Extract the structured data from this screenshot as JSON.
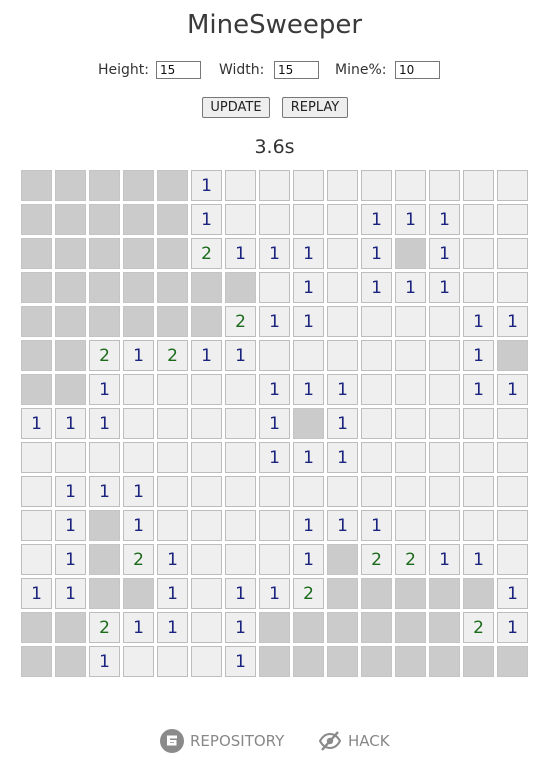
{
  "title": "MineSweeper",
  "settings": {
    "height_label": "Height:",
    "height_value": "15",
    "width_label": "Width:",
    "width_value": "15",
    "mine_label": "Mine%:",
    "mine_value": "10"
  },
  "buttons": {
    "update": "UPDATE",
    "replay": "REPLAY"
  },
  "timer": "3.6s",
  "board": {
    "rows": 15,
    "cols": 15,
    "legend": "#=covered, .=empty opened, digit=number",
    "grid": [
      "#####1.........",
      "#####1....111..",
      "#####2111.1#1..",
      "#######.1.111..",
      "######211....11",
      "##21211......1#",
      "##1....111...11",
      "111....1#1.....",
      ".......111.....",
      ".111...........",
      ".1#1....111....",
      ".1#21...1#2211.",
      "11##1.112#####1.",
      "##211.1######21",
      "##1...1########"
    ]
  },
  "colors": {
    "covered": "#cbcbcb",
    "open": "#efefef",
    "number_1": "#1a237e",
    "number_2": "#1b6b1b",
    "link": "#888888"
  },
  "footer": {
    "repository_label": "REPOSITORY",
    "repository_icon": "gitee-icon",
    "hack_label": "HACK",
    "hack_icon": "eye-slash-icon"
  }
}
